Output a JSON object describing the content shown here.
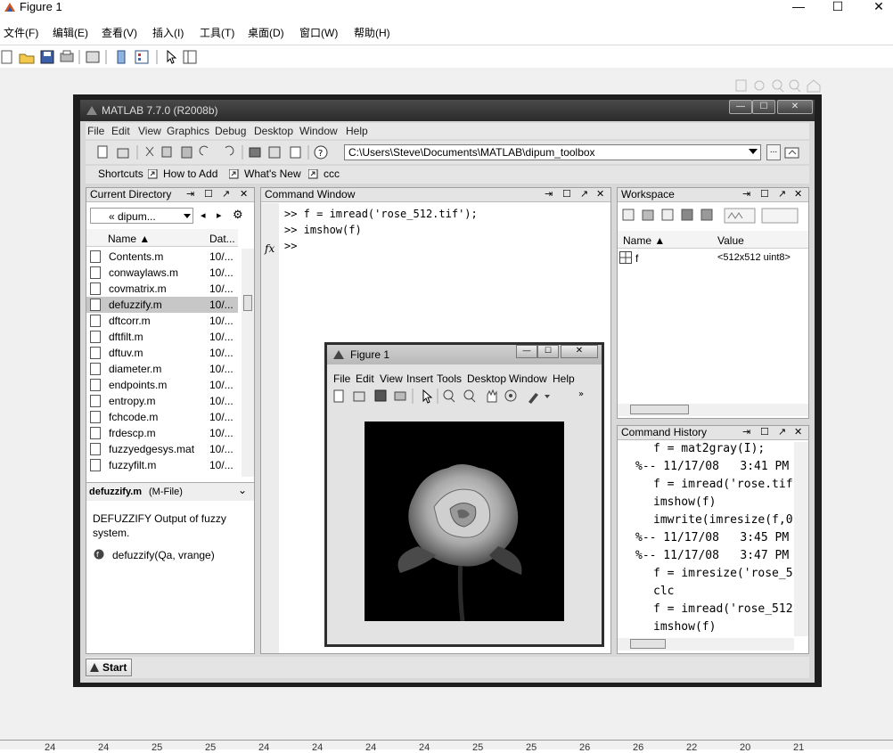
{
  "window": {
    "title": "Figure 1",
    "controls": [
      "—",
      "☐",
      "✕"
    ]
  },
  "menubar": [
    "文件(F)",
    "编辑(E)",
    "查看(V)",
    "插入(I)",
    "工具(T)",
    "桌面(D)",
    "窗口(W)",
    "帮助(H)"
  ],
  "matlab": {
    "title": "MATLAB  7.7.0 (R2008b)",
    "menu": [
      "File",
      "Edit",
      "Graphics",
      "Debug",
      "Desktop",
      "Window",
      "Help"
    ],
    "cwd": "C:\\Users\\Steve\\Documents\\MATLAB\\dipum_toolbox",
    "shortcuts": [
      "Shortcuts",
      "How to Add",
      "What's New",
      "ccc"
    ],
    "current_directory": {
      "title": "Current Directory",
      "folder": "« dipum...",
      "col_name": "Name ▲",
      "col_date": "Dat...",
      "files": [
        {
          "name": "Contents.m",
          "date": "10/..."
        },
        {
          "name": "conwaylaws.m",
          "date": "10/..."
        },
        {
          "name": "covmatrix.m",
          "date": "10/..."
        },
        {
          "name": "defuzzify.m",
          "date": "10/..."
        },
        {
          "name": "dftcorr.m",
          "date": "10/..."
        },
        {
          "name": "dftfilt.m",
          "date": "10/..."
        },
        {
          "name": "dftuv.m",
          "date": "10/..."
        },
        {
          "name": "diameter.m",
          "date": "10/..."
        },
        {
          "name": "endpoints.m",
          "date": "10/..."
        },
        {
          "name": "entropy.m",
          "date": "10/..."
        },
        {
          "name": "fchcode.m",
          "date": "10/..."
        },
        {
          "name": "frdescp.m",
          "date": "10/..."
        },
        {
          "name": "fuzzyedgesys.mat",
          "date": "10/..."
        },
        {
          "name": "fuzzyfilt.m",
          "date": "10/..."
        }
      ],
      "selected_index": 3,
      "detail_title": "defuzzify.m",
      "detail_type": "(M-File)",
      "detail_desc": "DEFUZZIFY Output of fuzzy system.",
      "detail_sig": "defuzzify(Qa, vrange)"
    },
    "command_window": {
      "title": "Command Window",
      "lines": [
        ">> f = imread('rose_512.tif');",
        ">> imshow(f)",
        ">>"
      ],
      "fx": "fx"
    },
    "workspace": {
      "title": "Workspace",
      "col_name": "Name ▲",
      "col_value": "Value",
      "var_name": "f",
      "var_value": "<512x512 uint8>"
    },
    "history": {
      "title": "Command History",
      "lines": [
        "f = mat2gray(I);",
        "%-- 11/17/08   3:41 PM",
        "f = imread('rose.tif",
        "imshow(f)",
        "imwrite(imresize(f,0",
        "%-- 11/17/08   3:45 PM",
        "%-- 11/17/08   3:47 PM",
        "f = imresize('rose_5",
        "clc",
        "f = imread('rose_512",
        "imshow(f)"
      ]
    },
    "start": "Start"
  },
  "figure1": {
    "title": "Figure 1",
    "menu": [
      "File",
      "Edit",
      "View",
      "Insert",
      "Tools",
      "Desktop",
      "Window",
      "Help"
    ]
  },
  "ruler": [
    "24",
    "24",
    "25",
    "25",
    "24",
    "24",
    "24",
    "24",
    "25",
    "25",
    "26",
    "26",
    "22",
    "20",
    "21"
  ],
  "colors": {
    "matlab_title": "#2b2b2b",
    "panel_header": "#e4e4e4",
    "selection": "#c7c7c7"
  }
}
